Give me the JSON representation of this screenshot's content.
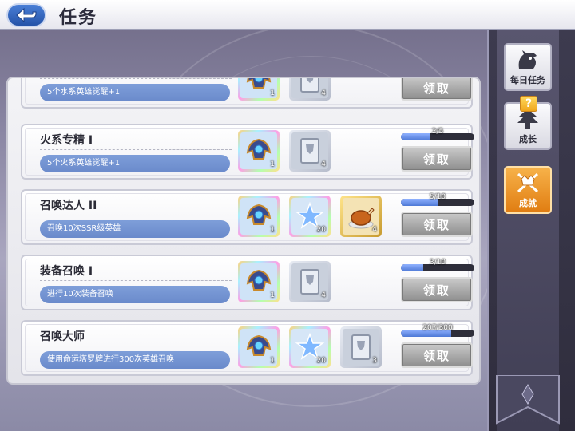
{
  "header": {
    "title": "任务"
  },
  "tasks": [
    {
      "title": "",
      "desc": "5个水系英雄觉醒+1",
      "progress_text": "",
      "progress_fraction": 0.0,
      "claim_label": "领取",
      "rewards": [
        {
          "icon": "helm-icon",
          "count": "1",
          "frame": "rainbow"
        },
        {
          "icon": "card-icon",
          "count": "4",
          "frame": "silver"
        }
      ]
    },
    {
      "title": "火系专精 I",
      "desc": "5个火系英雄觉醒+1",
      "progress_text": "2/5",
      "progress_fraction": 0.4,
      "claim_label": "领取",
      "rewards": [
        {
          "icon": "helm-icon",
          "count": "1",
          "frame": "rainbow"
        },
        {
          "icon": "card-icon",
          "count": "4",
          "frame": "silver"
        }
      ]
    },
    {
      "title": "召唤达人 II",
      "desc": "召唤10次SSR级英雄",
      "progress_text": "5/10",
      "progress_fraction": 0.5,
      "claim_label": "领取",
      "rewards": [
        {
          "icon": "helm-icon",
          "count": "1",
          "frame": "rainbow"
        },
        {
          "icon": "star-icon",
          "count": "20",
          "frame": "rainbow"
        },
        {
          "icon": "roast-chicken-icon",
          "count": "4",
          "frame": "gold"
        }
      ]
    },
    {
      "title": "装备召唤 I",
      "desc": "进行10次装备召唤",
      "progress_text": "3/10",
      "progress_fraction": 0.3,
      "claim_label": "领取",
      "rewards": [
        {
          "icon": "helm-icon",
          "count": "1",
          "frame": "rainbow"
        },
        {
          "icon": "card-icon",
          "count": "4",
          "frame": "silver"
        }
      ]
    },
    {
      "title": "召唤大师",
      "desc": "使用命运塔罗牌进行300次英雄召唤",
      "progress_text": "207/300",
      "progress_fraction": 0.69,
      "claim_label": "领取",
      "rewards": [
        {
          "icon": "helm-icon",
          "count": "1",
          "frame": "rainbow"
        },
        {
          "icon": "star-icon",
          "count": "20",
          "frame": "rainbow"
        },
        {
          "icon": "card-icon",
          "count": "3",
          "frame": "silver"
        }
      ]
    }
  ],
  "sidebar": {
    "tabs": [
      {
        "label": "每日任务",
        "icon": "dragon-icon",
        "active": false
      },
      {
        "label": "成长",
        "icon": "tree-icon",
        "active": false,
        "badge": "?"
      },
      {
        "label": "成就",
        "icon": "crown-swords-icon",
        "active": true
      }
    ]
  },
  "colors": {
    "accent_orange": "#e88a1d",
    "desc_blue": "#7391cf",
    "button_gray": "#a8a8a8"
  }
}
